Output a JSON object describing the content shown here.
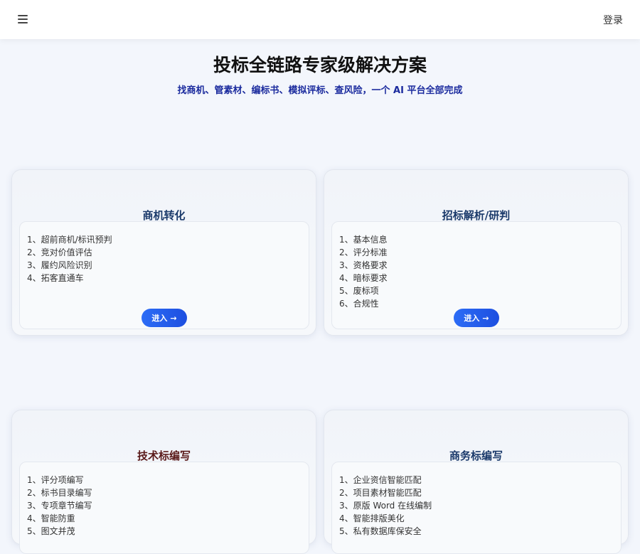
{
  "header": {
    "menu_icon": "hamburger-menu-icon",
    "login_label": "登录"
  },
  "hero": {
    "title": "投标全链路专家级解决方案",
    "subtitle": "找商机、管素材、编标书、模拟评标、查风险，一个 AI 平台全部完成"
  },
  "cards": [
    {
      "title": "商机转化",
      "items": [
        "1、超前商机/标讯预判",
        "2、竞对价值评估",
        "3、履约风险识别",
        "4、拓客直通车"
      ],
      "button_label": "进入",
      "button_icon": "arrow-right-icon"
    },
    {
      "title": "招标解析/研判",
      "items": [
        "1、基本信息",
        "2、评分标准",
        "3、资格要求",
        "4、暗标要求",
        "5、废标项",
        "6、合规性"
      ],
      "button_label": "进入",
      "button_icon": "arrow-right-icon"
    },
    {
      "title": "技术标编写",
      "items": [
        "1、评分项编写",
        "2、标书目录编写",
        "3、专项章节编写",
        "4、智能防重",
        "5、图文并茂"
      ]
    },
    {
      "title": "商务标编写",
      "items": [
        "1、企业资信智能匹配",
        "2、项目素材智能匹配",
        "3、原版 Word 在线编制",
        "4、智能排版美化",
        "5、私有数据库保安全"
      ]
    }
  ],
  "colors": {
    "background": "#f3f6fc",
    "accent": "#1d4fe0",
    "subtitle": "#1b2b9e"
  }
}
